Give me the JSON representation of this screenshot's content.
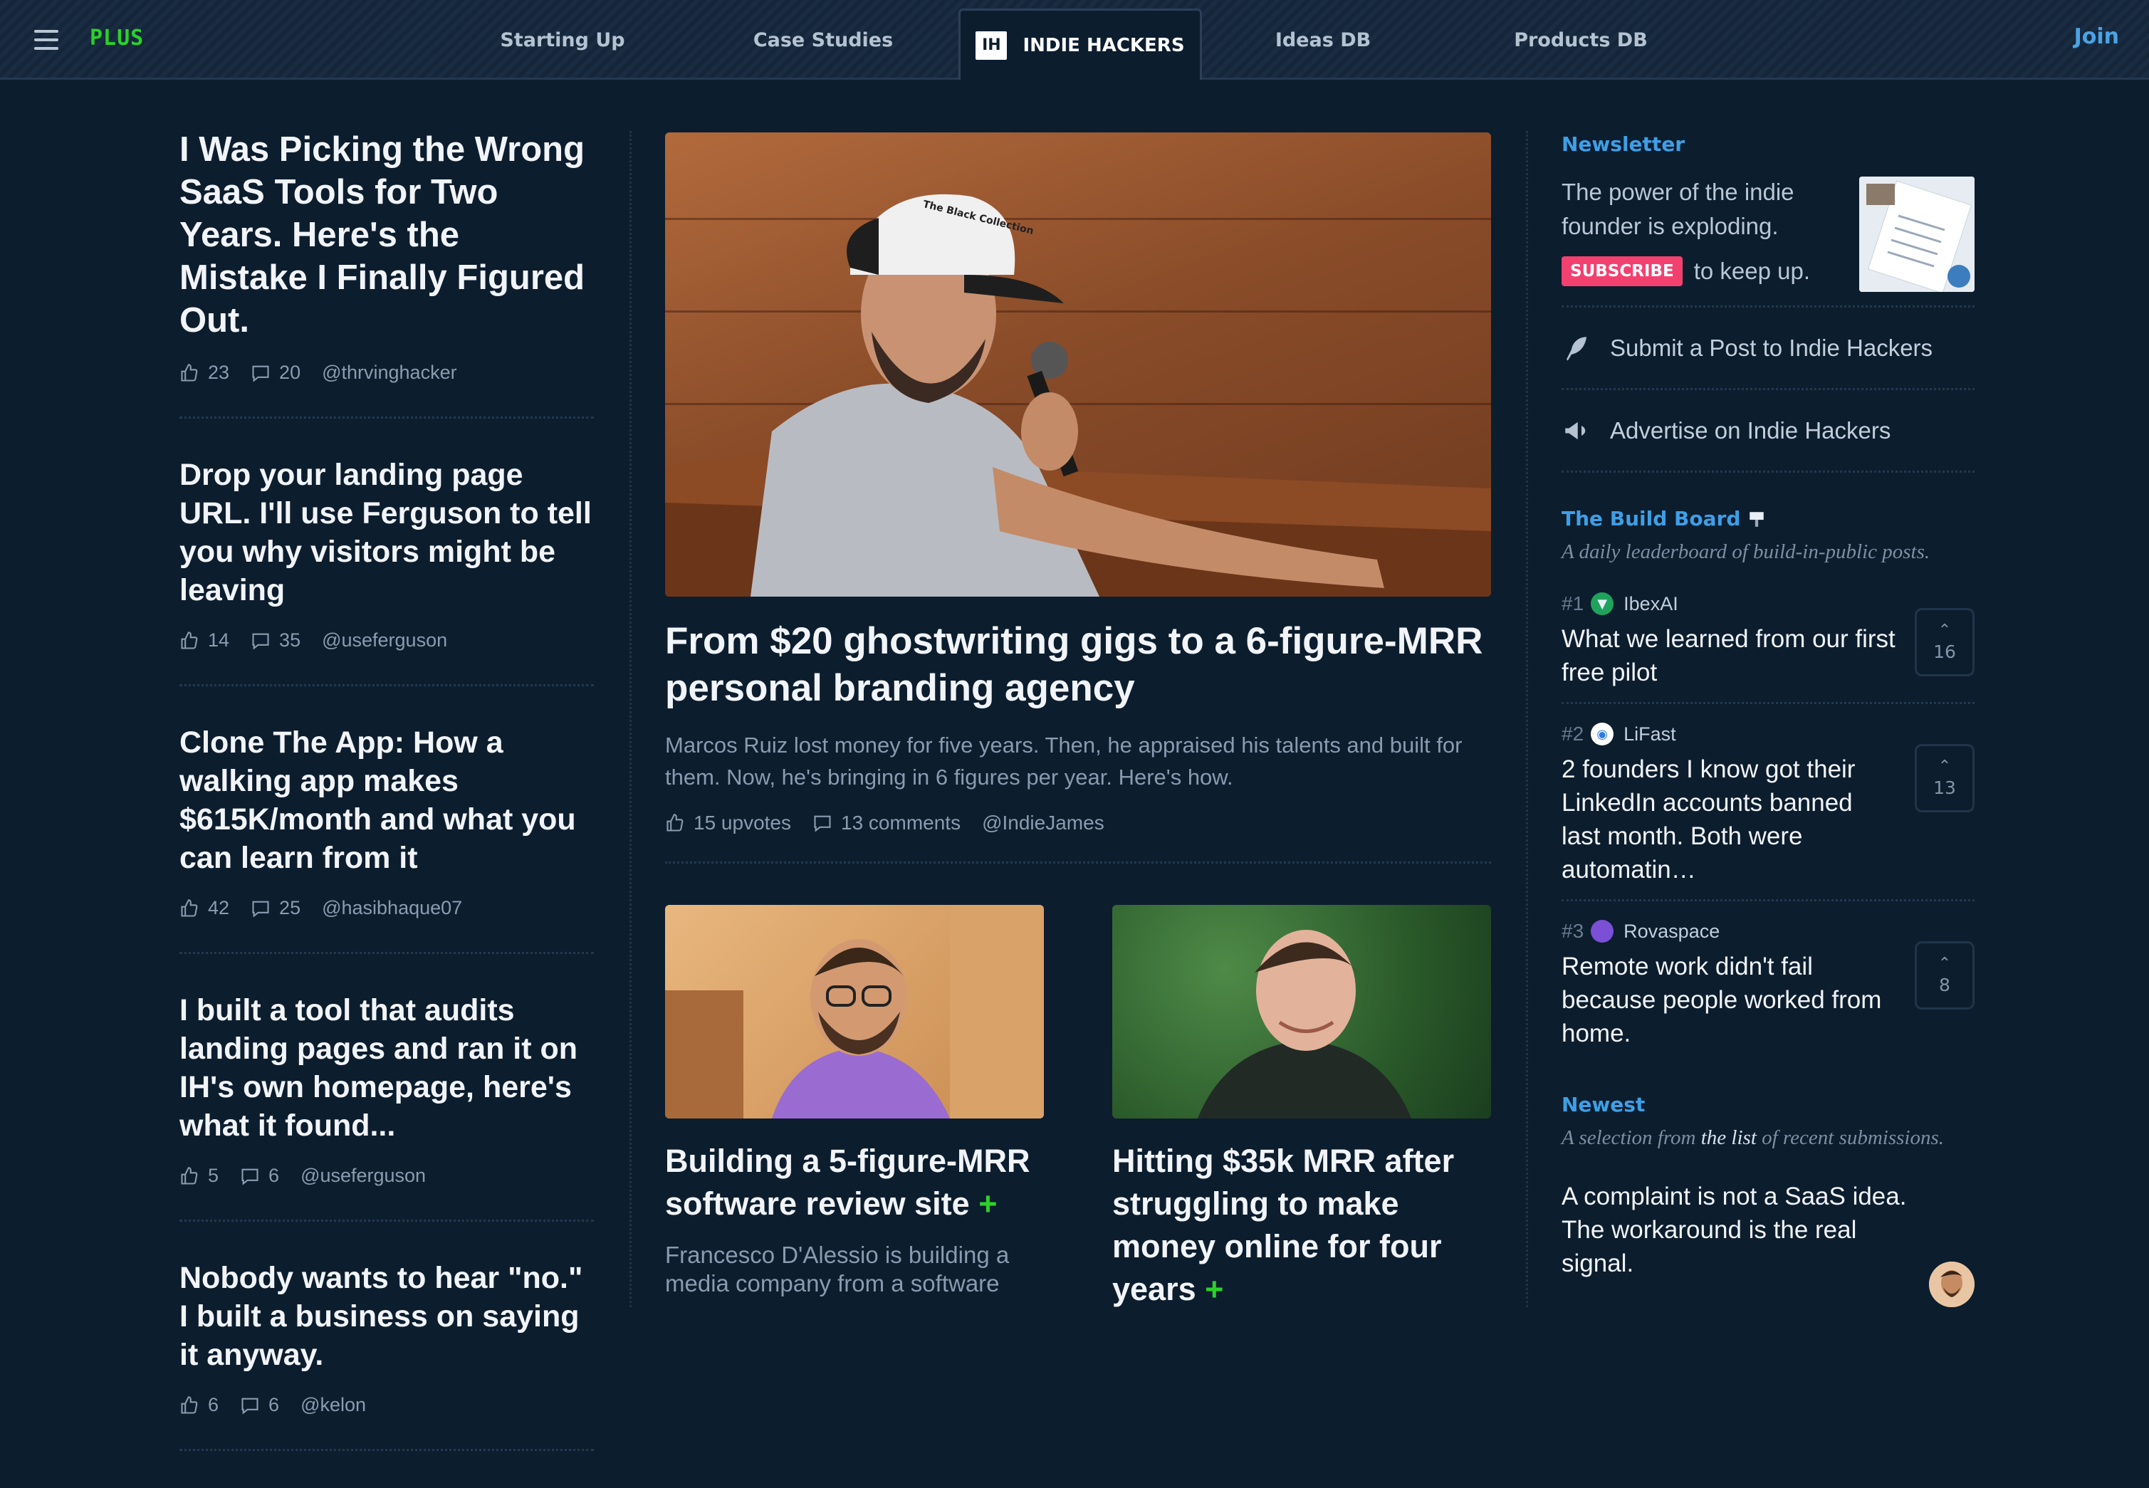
{
  "nav": {
    "logo": "PLUS",
    "tabs": [
      "Starting Up",
      "Case Studies",
      "INDIE HACKERS",
      "Ideas DB",
      "Products DB"
    ],
    "ih_mark": "IH",
    "join": "Join"
  },
  "left_posts": [
    {
      "title": "I Was Picking the Wrong SaaS Tools for Two Years. Here's the Mistake I Finally Figured Out.",
      "upvotes": "23",
      "comments": "20",
      "author": "@thrvinghacker"
    },
    {
      "title": "Drop your landing page URL. I'll use Ferguson to tell you why visitors might be leaving",
      "upvotes": "14",
      "comments": "35",
      "author": "@useferguson"
    },
    {
      "title": "Clone The App: How a walking app makes $615K/month and what you can learn from it",
      "upvotes": "42",
      "comments": "25",
      "author": "@hasibhaque07"
    },
    {
      "title": "I built a tool that audits landing pages and ran it on IH's own homepage, here's what it found...",
      "upvotes": "5",
      "comments": "6",
      "author": "@useferguson"
    },
    {
      "title": "Nobody wants to hear \"no.\" I built a business on saying it anyway.",
      "upvotes": "6",
      "comments": "6",
      "author": "@kelon"
    }
  ],
  "hero": {
    "title": "From $20 ghostwriting gigs to a 6-figure-MRR personal branding agency",
    "subtitle": "Marcos Ruiz lost money for five years. Then, he appraised his talents and built for them. Now, he's bringing in 6 figures per year. Here's how.",
    "upvotes": "15 upvotes",
    "comments": "13 comments",
    "author": "@IndieJames",
    "cap_text": "The Black Collection"
  },
  "cards": [
    {
      "title": "Building a 5-figure-MRR software review site",
      "subtitle": "Francesco D'Alessio is building a media company from a software"
    },
    {
      "title": "Hitting $35k MRR after struggling to make money online for four years",
      "subtitle": ""
    }
  ],
  "newsletter": {
    "label": "Newsletter",
    "text": "The power of the indie founder is exploding.",
    "subscribe": "SUBSCRIBE",
    "tail": "to keep up."
  },
  "actions": [
    {
      "label": "Submit a Post to Indie Hackers",
      "icon": "feather-icon"
    },
    {
      "label": "Advertise on Indie Hackers",
      "icon": "megaphone-icon"
    }
  ],
  "build_board": {
    "label": "The Build Board",
    "desc": "A daily leaderboard of build-in-public posts.",
    "items": [
      {
        "rank": "#1",
        "brand": "IbexAI",
        "title": "What we learned from our first free pilot",
        "votes": "16",
        "color": "#1fa35c"
      },
      {
        "rank": "#2",
        "brand": "LiFast",
        "title": "2 founders I know got their LinkedIn accounts banned last month. Both were automatin…",
        "votes": "13",
        "color": "#2c7be5"
      },
      {
        "rank": "#3",
        "brand": "Rovaspace",
        "title": "Remote work didn't fail because people worked from home.",
        "votes": "8",
        "color": "#7b4fd6"
      }
    ]
  },
  "newest": {
    "label": "Newest",
    "desc_pre": "A selection from ",
    "desc_link": "the list",
    "desc_post": " of recent submissions.",
    "title": "A complaint is not a SaaS idea. The workaround is the real signal."
  }
}
